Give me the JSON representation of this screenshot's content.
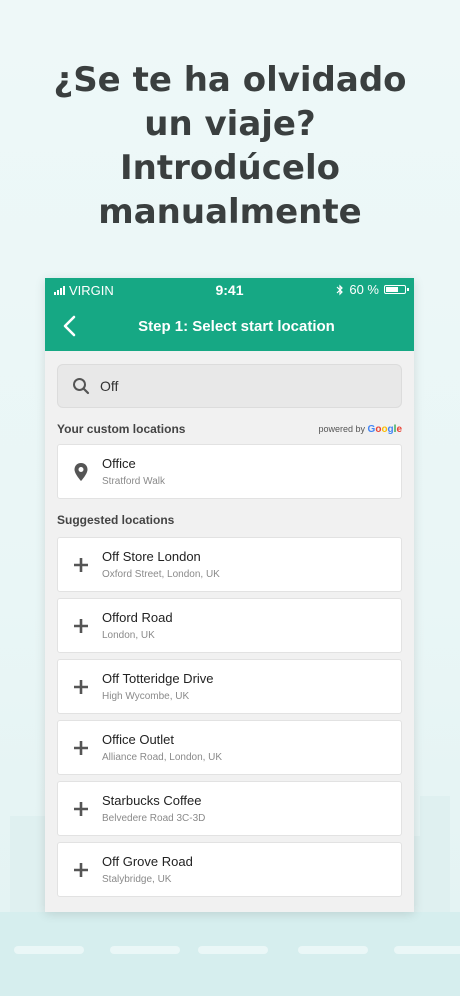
{
  "headline": {
    "lines": [
      "¿Se te ha olvidado",
      "un viaje?",
      "Introdúcelo",
      "manualmente"
    ]
  },
  "statusbar": {
    "carrier": "VIRGIN",
    "time": "9:41",
    "battery_text": "60 %",
    "icons": [
      "signal-icon",
      "bluetooth-icon",
      "battery-icon"
    ]
  },
  "navbar": {
    "back_icon": "chevron-left-icon",
    "title": "Step 1: Select start location"
  },
  "search": {
    "value": "Off",
    "icon": "search-icon"
  },
  "custom": {
    "title": "Your custom locations",
    "powered_by": "powered by",
    "google": "Google",
    "items": [
      {
        "name": "Office",
        "sub": "Stratford Walk",
        "icon": "pin-icon"
      }
    ]
  },
  "suggested": {
    "title": "Suggested locations",
    "items": [
      {
        "name": "Off Store London",
        "sub": "Oxford Street, London, UK",
        "icon": "plus-icon"
      },
      {
        "name": "Offord Road",
        "sub": "London, UK",
        "icon": "plus-icon"
      },
      {
        "name": "Off Totteridge Drive",
        "sub": "High Wycombe, UK",
        "icon": "plus-icon"
      },
      {
        "name": "Office Outlet",
        "sub": "Alliance Road, London, UK",
        "icon": "plus-icon"
      },
      {
        "name": "Starbucks Coffee",
        "sub": "Belvedere Road 3C-3D",
        "icon": "plus-icon"
      },
      {
        "name": "Off Grove Road",
        "sub": "Stalybridge, UK",
        "icon": "plus-icon"
      }
    ]
  },
  "colors": {
    "brand_green": "#16a884",
    "headline_text": "#3a3f3f",
    "background": "#eef8f8"
  }
}
